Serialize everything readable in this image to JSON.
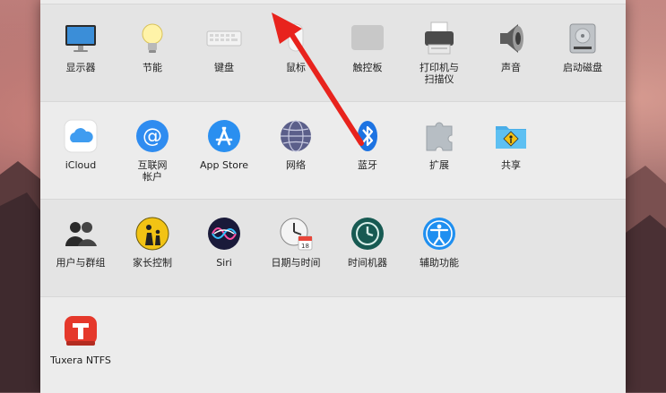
{
  "rows": [
    [
      {
        "name": "display",
        "label": "显示器",
        "icon": "display-icon"
      },
      {
        "name": "energy",
        "label": "节能",
        "icon": "lightbulb-icon"
      },
      {
        "name": "keyboard",
        "label": "键盘",
        "icon": "keyboard-icon"
      },
      {
        "name": "mouse",
        "label": "鼠标",
        "icon": "mouse-icon"
      },
      {
        "name": "trackpad",
        "label": "触控板",
        "icon": "trackpad-icon"
      },
      {
        "name": "printers",
        "label": "打印机与\n扫描仪",
        "icon": "printer-icon"
      },
      {
        "name": "sound",
        "label": "声音",
        "icon": "speaker-icon"
      },
      {
        "name": "startup-disk",
        "label": "启动磁盘",
        "icon": "hard-drive-icon"
      }
    ],
    [
      {
        "name": "icloud",
        "label": "iCloud",
        "icon": "cloud-icon"
      },
      {
        "name": "internet-accounts",
        "label": "互联网\n帐户",
        "icon": "at-sign-icon"
      },
      {
        "name": "app-store",
        "label": "App Store",
        "icon": "app-store-icon"
      },
      {
        "name": "network",
        "label": "网络",
        "icon": "globe-icon"
      },
      {
        "name": "bluetooth",
        "label": "蓝牙",
        "icon": "bluetooth-icon"
      },
      {
        "name": "extensions",
        "label": "扩展",
        "icon": "puzzle-icon"
      },
      {
        "name": "sharing",
        "label": "共享",
        "icon": "sharing-folder-icon"
      }
    ],
    [
      {
        "name": "users-groups",
        "label": "用户与群组",
        "icon": "users-icon"
      },
      {
        "name": "parental-controls",
        "label": "家长控制",
        "icon": "parental-controls-icon"
      },
      {
        "name": "siri",
        "label": "Siri",
        "icon": "siri-icon"
      },
      {
        "name": "date-time",
        "label": "日期与时间",
        "icon": "clock-calendar-icon"
      },
      {
        "name": "time-machine",
        "label": "时间机器",
        "icon": "time-machine-icon"
      },
      {
        "name": "accessibility",
        "label": "辅助功能",
        "icon": "accessibility-icon"
      }
    ],
    [
      {
        "name": "tuxera-ntfs",
        "label": "Tuxera NTFS",
        "icon": "tuxera-icon"
      }
    ]
  ],
  "calendar_day": "18",
  "colors": {
    "arrow": "#e8231d",
    "window_bg": "#ececec"
  }
}
